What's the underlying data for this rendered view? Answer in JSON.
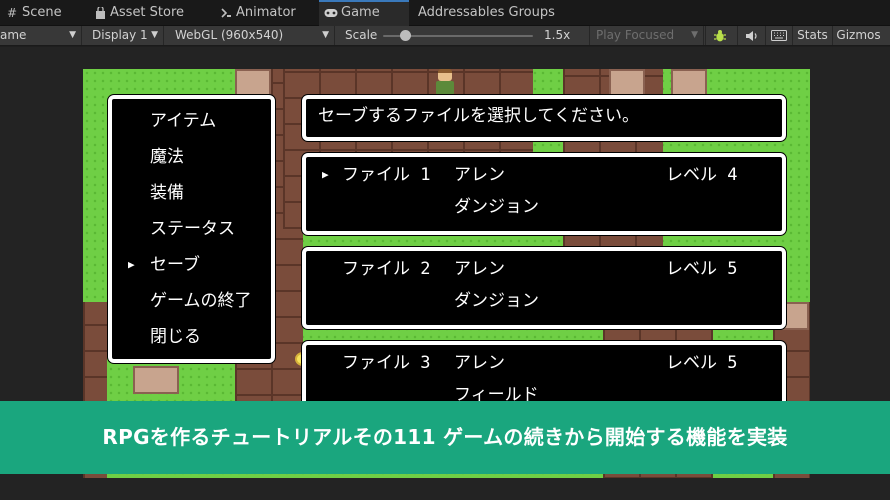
{
  "tabs": [
    {
      "label": "Scene",
      "icon": "hash-icon"
    },
    {
      "label": "Asset Store",
      "icon": "bag-icon"
    },
    {
      "label": "Animator",
      "icon": "animator-icon"
    },
    {
      "label": "Game",
      "icon": "gamepad-icon"
    },
    {
      "label": "Addressables Groups",
      "icon": ""
    }
  ],
  "toolbar": {
    "view_mode": "ame",
    "display": "Display 1",
    "resolution": "WebGL (960x540)",
    "scale_label": "Scale",
    "scale_value": "1.5x",
    "scale_fraction": 0.15,
    "play_mode": "Play Focused",
    "stats": "Stats",
    "gizmos": "Gizmos"
  },
  "game": {
    "menu": [
      "アイテム",
      "魔法",
      "装備",
      "ステータス",
      "セーブ",
      "ゲームの終了",
      "閉じる"
    ],
    "menu_selected_index": 4,
    "message": "セーブするファイルを選択してください。",
    "slots": [
      {
        "file": "ファイル 1",
        "name": "アレン",
        "level": "レベル  4",
        "place": "ダンジョン",
        "selected": true
      },
      {
        "file": "ファイル 2",
        "name": "アレン",
        "level": "レベル  5",
        "place": "ダンジョン",
        "selected": false
      },
      {
        "file": "ファイル 3",
        "name": "アレン",
        "level": "レベル  5",
        "place": "フィールド",
        "selected": false
      }
    ]
  },
  "banner": {
    "title": "RPGを作るチュートリアルその111 ゲームの続きから開始する機能を実装",
    "color": "#1aa67e"
  }
}
